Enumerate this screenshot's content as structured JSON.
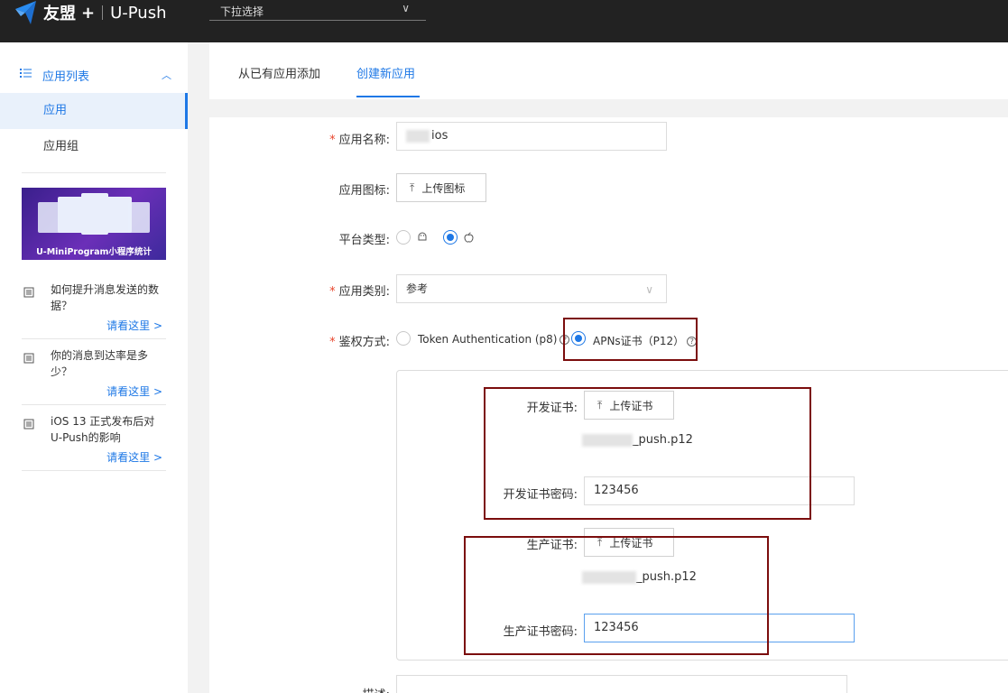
{
  "header": {
    "brand": "友盟",
    "brand_plus": "+",
    "product": "U-Push",
    "app_select_placeholder": "下拉选择"
  },
  "sidebar": {
    "section_title": "应用列表",
    "items": [
      {
        "label": "应用",
        "active": true
      },
      {
        "label": "应用组",
        "active": false
      }
    ],
    "banner_text": "U-MiniProgram小程序统计",
    "faq": [
      {
        "question": "如何提升消息发送的数据？",
        "link": "请看这里 >"
      },
      {
        "question": "你的消息到达率是多少？",
        "link": "请看这里 >"
      },
      {
        "question": "iOS 13 正式发布后对U-Push的影响",
        "link": "请看这里 >"
      }
    ]
  },
  "tabs": [
    {
      "label": "从已有应用添加",
      "active": false
    },
    {
      "label": "创建新应用",
      "active": true
    }
  ],
  "form": {
    "app_name_label": "应用名称:",
    "app_name_value": "ios",
    "app_icon_label": "应用图标:",
    "app_icon_button": "上传图标",
    "platform_label": "平台类型:",
    "platform_options": [
      "android",
      "ios"
    ],
    "platform_selected": "ios",
    "category_label": "应用类别:",
    "category_value": "参考",
    "auth_label": "鉴权方式:",
    "auth_option_token": "Token Authentication (p8)",
    "auth_option_apns": "APNs证书（P12）",
    "auth_selected": "apns",
    "dev_cert_label": "开发证书:",
    "dev_cert_button": "上传证书",
    "dev_cert_file": "_push.p12",
    "dev_cert_pwd_label": "开发证书密码:",
    "dev_cert_pwd_value": "123456",
    "prod_cert_label": "生产证书:",
    "prod_cert_button": "上传证书",
    "prod_cert_file": "_push.p12",
    "prod_cert_pwd_label": "生产证书密码:",
    "prod_cert_pwd_value": "123456",
    "desc_label": "描述:"
  },
  "colors": {
    "accent": "#1e78e6",
    "topbar": "#222222",
    "highlight_box": "#7b0d0d",
    "required": "#e8452c"
  }
}
